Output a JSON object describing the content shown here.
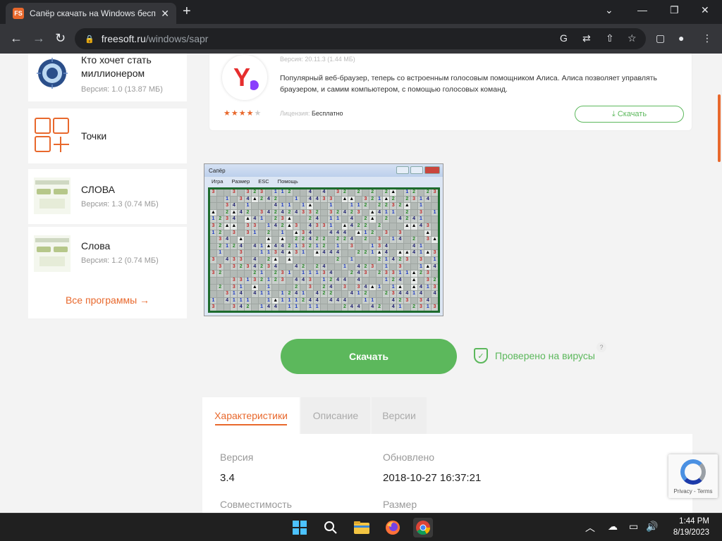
{
  "browser": {
    "tab_title": "Сапёр скачать на Windows бесп",
    "tab_favicon": "FS",
    "url_host": "freesoft.ru",
    "url_path": "/windows/sapr"
  },
  "sidebar": {
    "items": [
      {
        "name": "Кто хочет стать миллионером",
        "version": "Версия: 1.0 (13.87 МБ)"
      },
      {
        "name": "Точки",
        "version": ""
      },
      {
        "name": "СЛОВА",
        "version": "Версия: 1.3 (0.74 МБ)"
      },
      {
        "name": "Слова",
        "version": "Версия: 1.2 (0.74 МБ)"
      }
    ],
    "all_programs": "Все программы →"
  },
  "ad_card": {
    "version": "Версия: 20.11.3 (1.44 МБ)",
    "description": "Популярный веб-браузер, теперь со встроенным голосовым помощником Алиса. Алиса позволяет управлять браузером, и самим компьютером, с помощью голосовых команд.",
    "license_label": "Лицензия:",
    "license_value": "Бесплатно",
    "rating": 4,
    "download_label": "Скачать"
  },
  "screenshot_window": {
    "title": "Сапёр",
    "menu": [
      "Игра",
      "Размер",
      "ESC",
      "Помощь"
    ]
  },
  "download_button": "Скачать",
  "virus_check": "Проверено на вирусы",
  "virus_help": "?",
  "tabs": [
    "Характеристики",
    "Описание",
    "Версии"
  ],
  "specs": {
    "version_label": "Версия",
    "version_value": "3.4",
    "updated_label": "Обновлено",
    "updated_value": "2018-10-27 16:37:21",
    "compat_label": "Совместимость",
    "size_label": "Размер"
  },
  "recaptcha": "Privacy - Terms",
  "taskbar": {
    "time": "1:44 PM",
    "date": "8/19/2023"
  },
  "colors": {
    "accent": "#e8682c",
    "green": "#5cb85c"
  }
}
